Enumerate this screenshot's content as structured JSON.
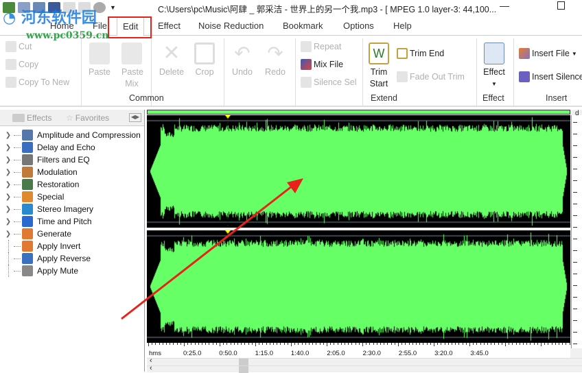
{
  "title": "C:\\Users\\pc\\Music\\阿肆 _ 郭采洁 - 世界上的另一个我.mp3 - [ MPEG 1.0 layer-3: 44,100...",
  "tabs": [
    "Home",
    "File",
    "Edit",
    "Effect",
    "Noise Reduction",
    "Bookmark",
    "Options",
    "Help"
  ],
  "active_tab": "Edit",
  "ribbon": {
    "cut": "Cut",
    "copy": "Copy",
    "copy_to_new": "Copy To New",
    "paste": "Paste",
    "paste_mix": "Paste Mix",
    "delete": "Delete",
    "crop": "Crop",
    "undo": "Undo",
    "redo": "Redo",
    "common": "Common",
    "repeat": "Repeat",
    "mix_file": "Mix File",
    "silence_sel": "Silence Sel",
    "trim_start": "Trim Start",
    "trim_end": "Trim End",
    "fade_out_trim": "Fade Out Trim",
    "extend": "Extend",
    "effect_btn": "Effect",
    "effect_group": "Effect",
    "insert_file": "Insert File",
    "insert_silence": "Insert Silence",
    "insert": "Insert"
  },
  "left_panel": {
    "tab_effects": "Effects",
    "tab_favorites": "Favorites",
    "items": [
      {
        "label": "Amplitude and Compression",
        "expandable": true,
        "color": "#5577aa"
      },
      {
        "label": "Delay and Echo",
        "expandable": true,
        "color": "#3a6fc0"
      },
      {
        "label": "Filters and EQ",
        "expandable": true,
        "color": "#777"
      },
      {
        "label": "Modulation",
        "expandable": true,
        "color": "#c07a3a"
      },
      {
        "label": "Restoration",
        "expandable": true,
        "color": "#4a7a4a"
      },
      {
        "label": "Special",
        "expandable": true,
        "color": "#e08a30"
      },
      {
        "label": "Stereo Imagery",
        "expandable": true,
        "color": "#2a8ad0"
      },
      {
        "label": "Time and Pitch",
        "expandable": true,
        "color": "#2a6ad0"
      },
      {
        "label": "Generate",
        "expandable": true,
        "color": "#e07a30"
      },
      {
        "label": "Apply Invert",
        "expandable": false,
        "color": "#e07a30"
      },
      {
        "label": "Apply Reverse",
        "expandable": false,
        "color": "#3a70c0"
      },
      {
        "label": "Apply Mute",
        "expandable": false,
        "color": "#888"
      }
    ]
  },
  "timeline": {
    "unit": "hms",
    "ticks": [
      "0:25.0",
      "0:50.0",
      "1:15.0",
      "1:40.0",
      "2:05.0",
      "2:30.0",
      "2:55.0",
      "3:20.0",
      "3:45.0"
    ]
  },
  "scale_label": "d",
  "waveform_color": "#66ff66",
  "watermark": {
    "name": "河东软件园",
    "url": "www.pc0359.cn"
  }
}
